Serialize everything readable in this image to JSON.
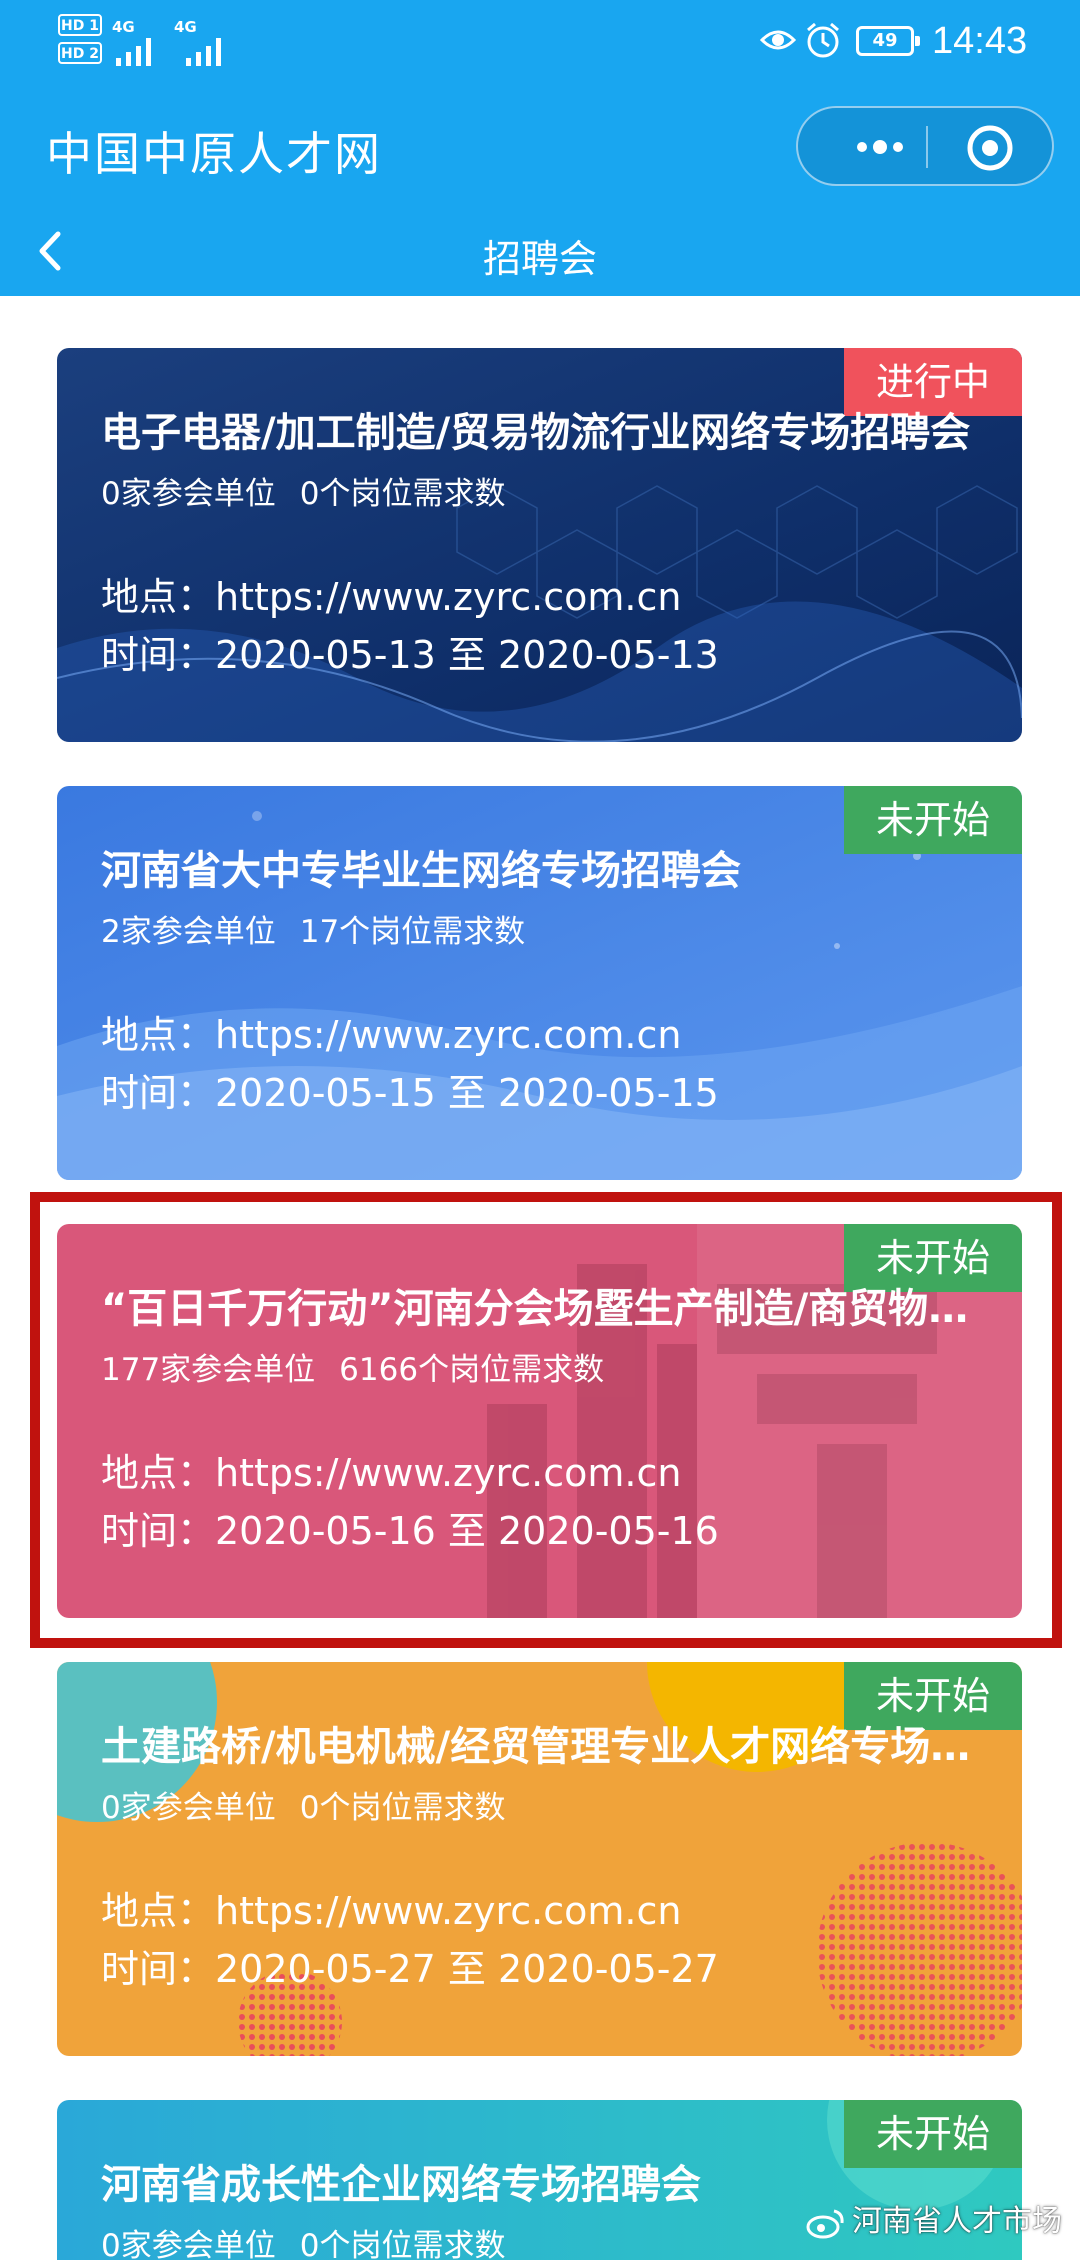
{
  "status_bar": {
    "sim1": "HD 1",
    "sim2": "HD 2",
    "network1": "4G",
    "network2": "4G",
    "battery": "49",
    "time": "14:43"
  },
  "header": {
    "app_title": "中国中原人才网",
    "page_title": "招聘会"
  },
  "colors": {
    "header_bg": "#19a6f0",
    "badge_active": "#f0525c",
    "badge_pending": "#3fa85e",
    "highlight_border": "#c0120e"
  },
  "fairs": [
    {
      "status": "进行中",
      "title": "电子电器/加工制造/贸易物流行业网络专场招聘会",
      "companies": "0家参会单位",
      "positions": "0个岗位需求数",
      "location": "地点：https://www.zyrc.com.cn",
      "time": "时间：2020-05-13 至 2020-05-13",
      "theme": "navy"
    },
    {
      "status": "未开始",
      "title": "河南省大中专毕业生网络专场招聘会",
      "companies": "2家参会单位",
      "positions": "17个岗位需求数",
      "location": "地点：https://www.zyrc.com.cn",
      "time": "时间：2020-05-15 至 2020-05-15",
      "theme": "blue"
    },
    {
      "status": "未开始",
      "title": "“百日千万行动”河南分会场暨生产制造/商贸物流网络专场招聘会",
      "companies": "177家参会单位",
      "positions": "6166个岗位需求数",
      "location": "地点：https://www.zyrc.com.cn",
      "time": "时间：2020-05-16 至 2020-05-16",
      "theme": "pink"
    },
    {
      "status": "未开始",
      "title": "土建路桥/机电机械/经贸管理专业人才网络专场招聘会",
      "companies": "0家参会单位",
      "positions": "0个岗位需求数",
      "location": "地点：https://www.zyrc.com.cn",
      "time": "时间：2020-05-27 至 2020-05-27",
      "theme": "orange"
    },
    {
      "status": "未开始",
      "title": "河南省成长性企业网络专场招聘会",
      "companies": "0家参会单位",
      "positions": "0个岗位需求数",
      "location": "",
      "time": "",
      "theme": "teal"
    }
  ],
  "watermark": "河南省人才市场"
}
